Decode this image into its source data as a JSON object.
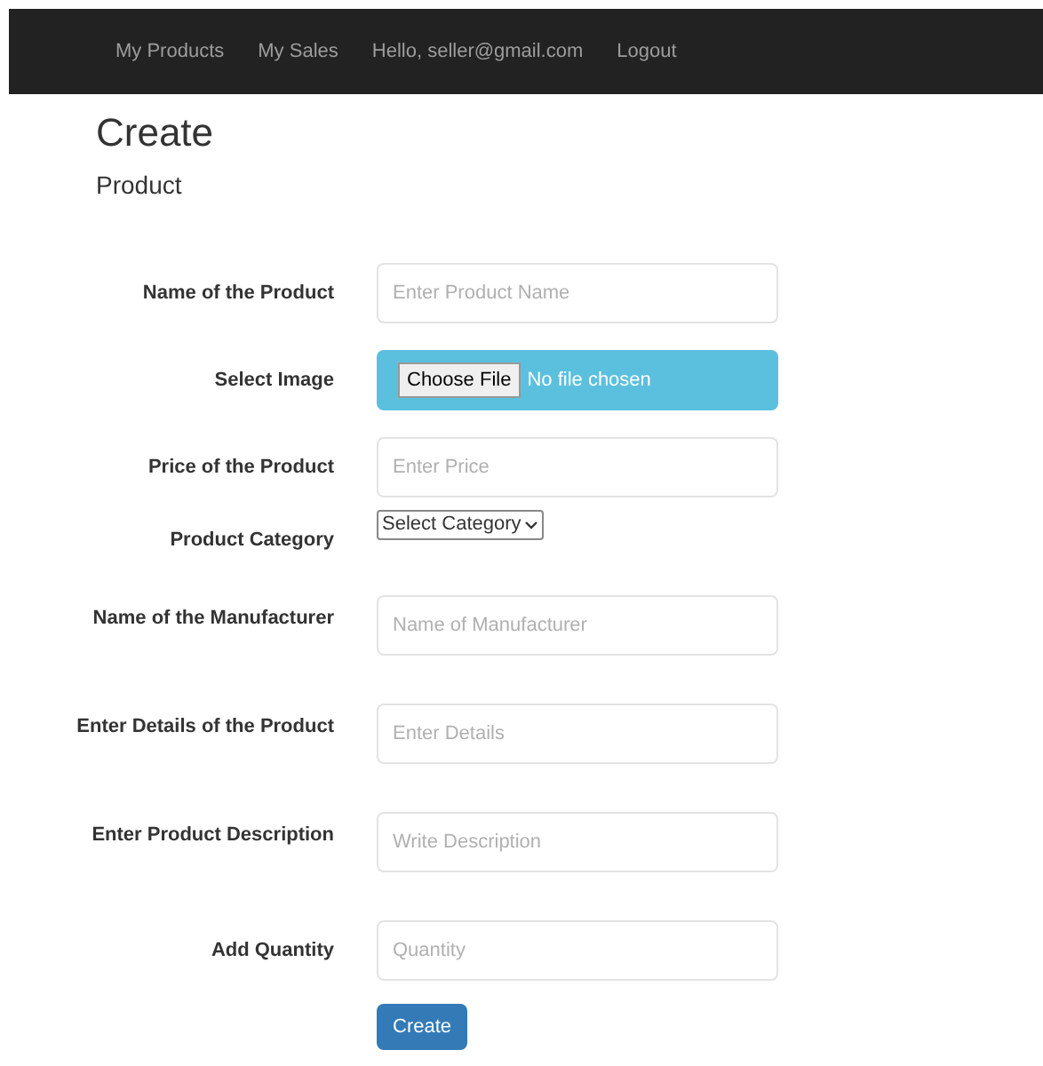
{
  "navbar": {
    "links": [
      "My Products",
      "My Sales",
      "Hello, seller@gmail.com",
      "Logout"
    ]
  },
  "heading": "Create",
  "subheading": "Product",
  "form": {
    "fields": [
      {
        "kind": "text",
        "label": "Name of the Product",
        "placeholder": "Enter Product Name"
      },
      {
        "kind": "file",
        "label": "Select Image",
        "button": "Choose File",
        "status": "No file chosen"
      },
      {
        "kind": "text",
        "label": "Price of the Product",
        "placeholder": "Enter Price"
      },
      {
        "kind": "select",
        "label": "Product Category",
        "value": "Select Category"
      },
      {
        "kind": "text",
        "label": "Name of the Manufacturer",
        "placeholder": "Name of Manufacturer"
      },
      {
        "kind": "text",
        "label": "Enter Details of the Product",
        "placeholder": "Enter Details"
      },
      {
        "kind": "text",
        "label": "Enter Product Description",
        "placeholder": "Write Description"
      },
      {
        "kind": "text",
        "label": "Add Quantity",
        "placeholder": "Quantity"
      }
    ],
    "submit": "Create"
  }
}
